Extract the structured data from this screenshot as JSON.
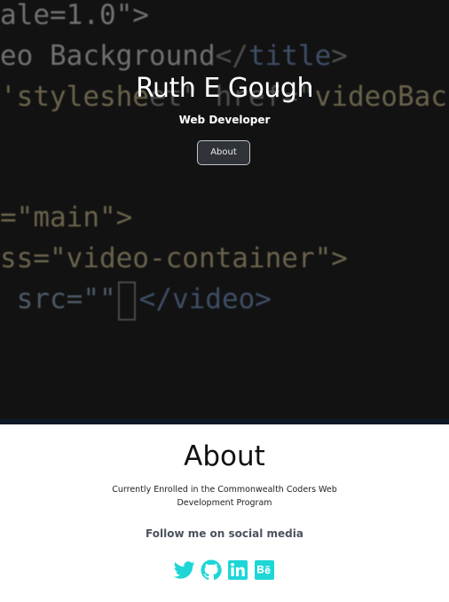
{
  "hero": {
    "title": "Ruth E Gough",
    "subtitle": "Web Developer",
    "about_button": "About",
    "code_lines": [
      {
        "parts": [
          {
            "t": "ale=1.0\">",
            "c": "tok-text"
          }
        ]
      },
      {
        "parts": [
          {
            "t": "eo Background",
            "c": "tok-text"
          },
          {
            "t": "</",
            "c": "tok-punc"
          },
          {
            "t": "title",
            "c": "tok-tag"
          },
          {
            "t": ">",
            "c": "tok-punc"
          }
        ]
      },
      {
        "parts": [
          {
            "t": "'styleshe",
            "c": "tok-str"
          },
          {
            "t": "et\" href=\"",
            "c": "tok-punc"
          },
          {
            "t": "videoBack",
            "c": "tok-str"
          }
        ]
      },
      {
        "parts": [
          {
            "t": "=\"main\">",
            "c": "tok-str"
          }
        ]
      },
      {
        "parts": [
          {
            "t": "ss=\"video-container\">",
            "c": "tok-str"
          }
        ]
      },
      {
        "parts": [
          {
            "t": " src=\"\"",
            "c": "tok-attr"
          },
          {
            "t": "CURSOR",
            "c": "cursor"
          },
          {
            "t": "</video>",
            "c": "tok-tag"
          }
        ]
      }
    ]
  },
  "about": {
    "title": "About",
    "text": "Currently Enrolled in the Commonwealth Coders Web Development Program",
    "follow": "Follow me on social media"
  },
  "socials": [
    {
      "name": "twitter-icon",
      "color": "#1fd6d6"
    },
    {
      "name": "github-icon",
      "color": "#1fd6d6"
    },
    {
      "name": "linkedin-icon",
      "color": "#1fd6d6"
    },
    {
      "name": "behance-icon",
      "color": "#1fd6d6"
    }
  ],
  "colors": {
    "accent": "#1fd6d6",
    "hero_bg": "#121212"
  }
}
